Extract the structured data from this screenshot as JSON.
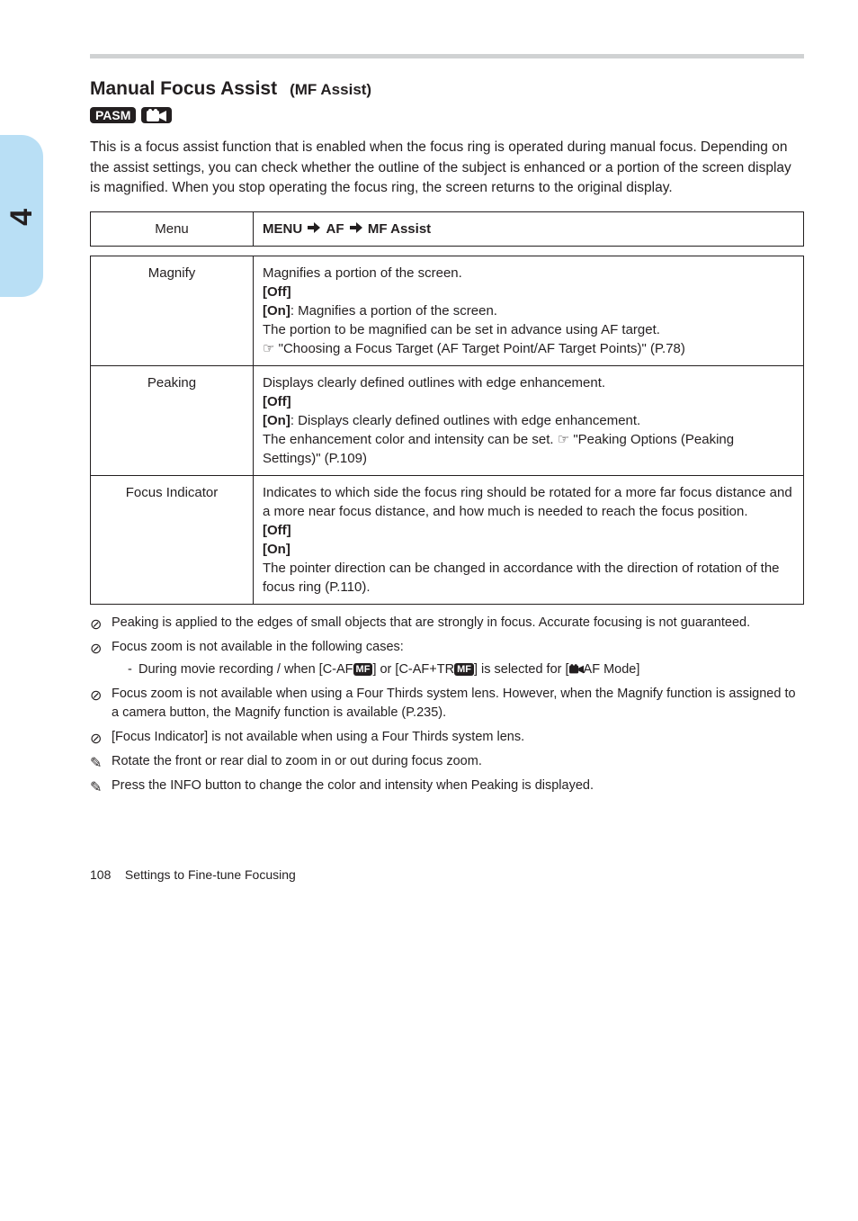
{
  "side_tab": "4",
  "section": {
    "title": "Manual Focus Assist",
    "subtitle": "(MF Assist)",
    "availability_label": "PASM"
  },
  "intro": "This is a focus assist function that is enabled when the focus ring is operated during manual focus. Depending on the assist settings, you can check whether the outline of the subject is enhanced or a portion of the screen display is magnified. When you stop operating the focus ring, the screen returns to the original display.",
  "menu_table": {
    "label": "Menu",
    "path_parts": [
      "MENU",
      "AF",
      "MF Assist"
    ]
  },
  "options": [
    {
      "name": "Magnify",
      "desc_head": "Magnifies a portion of the screen.",
      "off": "[Off]",
      "on_label": "[On]",
      "on_text": ": Magnifies a portion of the screen.",
      "extra": "The portion to be magnified can be set in advance using AF target.",
      "ref": "\"Choosing a Focus Target (AF Target Point/AF Target Points)\" (P.78)"
    },
    {
      "name": "Peaking",
      "desc_head": "Displays clearly defined outlines with edge enhancement.",
      "off": "[Off]",
      "on_label": "[On]",
      "on_text": ": Displays clearly defined outlines with edge enhancement.",
      "extra_pre": "The enhancement color and intensity can be set. ",
      "ref": "\"Peaking Options (Peaking Settings)\" (P.109)"
    },
    {
      "name": "Focus Indicator",
      "pre": "Indicates to which side the focus ring should be rotated for a more far focus distance and a more near focus distance, and how much is needed to reach the focus position.",
      "off": "[Off]",
      "on_label": "[On]",
      "post": "The pointer direction can be changed in accordance with the direction of rotation of the focus ring (P.110)."
    }
  ],
  "notes": [
    "Peaking is applied to the edges of small objects that are strongly in focus. Accurate focusing is not guaranteed.",
    "Focus zoom is not available in the following cases:",
    "Focus zoom is not available when using a Four Thirds system lens. However, when the Magnify function is assigned to a camera button, the Magnify function is available (P.235).",
    "[Focus Indicator] is not available when using a Four Thirds system lens.",
    "Rotate the front or rear dial to zoom in or out during focus zoom.",
    "Press the INFO button to change the color and intensity when Peaking is displayed."
  ],
  "note2_detail_prefix": "During movie recording / when [C-AF",
  "note2_detail_mid": "] or [C-AF+TR",
  "note2_detail_suffix": "] is selected for [",
  "note2_detail_tail": "AF Mode]",
  "page_number": "108",
  "page_section": "Settings to Fine-tune Focusing"
}
